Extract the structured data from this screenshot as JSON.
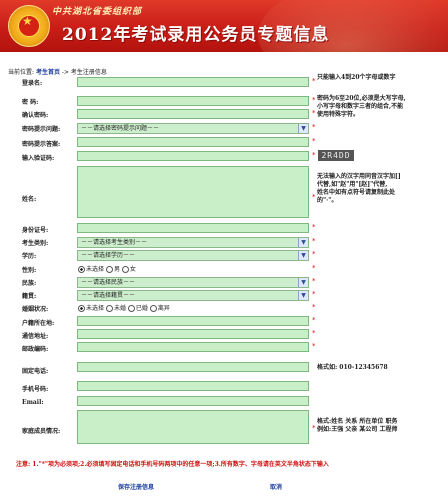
{
  "header": {
    "org": "中共湖北省委组织部",
    "title": "2012年考试录用公务员专题信息"
  },
  "breadcrumb": {
    "prefix": "当前位置:",
    "home": "考生首页",
    "sep": "->",
    "current": "考生注册信息"
  },
  "form": {
    "login": "登录名:",
    "password": "密  码:",
    "confirm": "确认密码:",
    "pwd_question": "密码提示问题:",
    "pwd_answer": "密码提示答案:",
    "captcha_label": "输入验证码:",
    "name": "姓名:",
    "id_no": "身份证号:",
    "category": "考生类别:",
    "education": "学历:",
    "gender": "性别:",
    "ethnicity": "民族:",
    "origin": "籍贯:",
    "marital": "婚姻状况:",
    "hukou": "户籍所在地:",
    "address": "通信地址:",
    "postcode": "邮政编码:",
    "phone": "固定电话:",
    "mobile": "手机号码:",
    "email": "Email:",
    "family": "家庭成员情况:"
  },
  "selects": {
    "question": "－－请选择密码提示问题－－",
    "category": "－－请选择考生类别－－",
    "education": "－－请选择学历－－",
    "ethnicity": "－－请选择民族－－",
    "origin": "－－请选择籍贯－－"
  },
  "radios": {
    "gender": [
      "未选择",
      "男",
      "女"
    ],
    "marital": [
      "未选择",
      "未婚",
      "已婚",
      "离异"
    ]
  },
  "captcha": "2R4DD",
  "notes": {
    "login": "只能输入4到20个字母或数字",
    "password_1": "密码为6至20位,必须是大写字母,",
    "password_2": "小写字母和数字三者的组合,不能",
    "password_3": "使用特殊字符。",
    "name_1": "无法输入的汉字用同音汉字加[]",
    "name_2": "代替,如\"赵\"用\"[赵]\"代替,",
    "name_3": "姓名中如有点符号请复制此处",
    "name_4": "的\"·\"。",
    "phone": "格式如: 010-12345678",
    "family_1": "格式:姓名 关系 所在单位 职务",
    "family_2": "例如:王强 父亲 某公司 工程师"
  },
  "warning": "注意: 1.\"*\"项为必须项;2.必须填写固定电话和手机号码两项中的任意一项;3.所有数字、字母请在英文半角状态下输入",
  "buttons": {
    "save": "保存注册信息",
    "cancel": "取消"
  }
}
